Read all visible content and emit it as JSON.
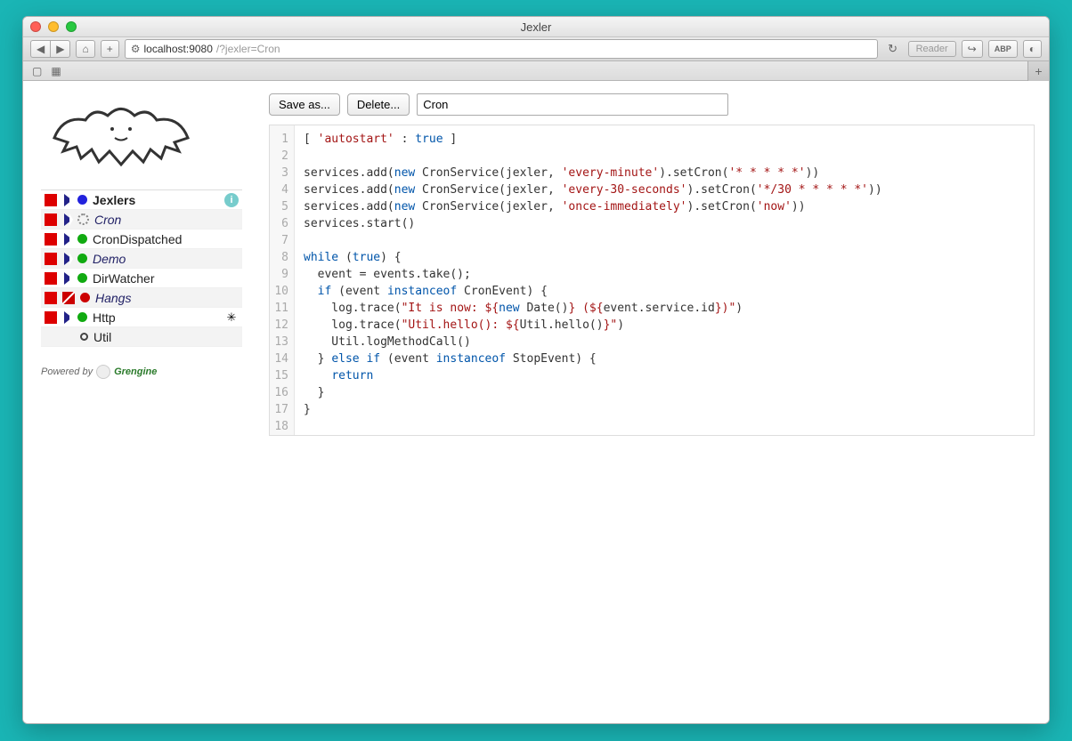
{
  "window": {
    "title": "Jexler"
  },
  "browser": {
    "url_host": "localhost:9080",
    "url_query": "/?jexler=Cron",
    "reader_label": "Reader"
  },
  "sidebar": {
    "items": [
      {
        "name": "Jexlers",
        "bold": true,
        "status": "blue",
        "trail": "info"
      },
      {
        "name": "Cron",
        "italic": true,
        "status": "spinner"
      },
      {
        "name": "CronDispatched",
        "status": "green"
      },
      {
        "name": "Demo",
        "italic": true,
        "status": "green"
      },
      {
        "name": "DirWatcher",
        "status": "green"
      },
      {
        "name": "Hangs",
        "italic": true,
        "status": "red",
        "diag": true
      },
      {
        "name": "Http",
        "status": "green",
        "trail": "cog"
      },
      {
        "name": "Util",
        "status": "ring",
        "nocontrols": true
      }
    ],
    "powered_by": "Powered by",
    "engine": "Grengine"
  },
  "toolbar": {
    "save_label": "Save as...",
    "delete_label": "Delete...",
    "name_value": "Cron"
  },
  "code": {
    "line_count": 18,
    "l1a": "[ ",
    "l1b": "'autostart'",
    "l1c": " : ",
    "l1d": "true",
    "l1e": " ]",
    "l3a": "services.add(",
    "l3b": "new",
    "l3c": " CronService(jexler, ",
    "l3d": "'every-minute'",
    "l3e": ").setCron(",
    "l3f": "'* * * * *'",
    "l3g": "))",
    "l4d": "'every-30-seconds'",
    "l4f": "'*/30 * * * * *'",
    "l5d": "'once-immediately'",
    "l5f": "'now'",
    "l6": "services.start()",
    "l8a": "while",
    "l8b": " (",
    "l8c": "true",
    "l8d": ") {",
    "l9": "  event = events.take();",
    "l10a": "  ",
    "l10b": "if",
    "l10c": " (event ",
    "l10d": "instanceof",
    "l10e": " CronEvent) {",
    "l11a": "    log.trace(",
    "l11b": "\"It is now: ${",
    "l11c": "new",
    "l11d": " Date()",
    "l11e": "} (${",
    "l11f": "event.service.id",
    "l11g": "})\"",
    "l11h": ")",
    "l12a": "    log.trace(",
    "l12b": "\"Util.hello(): ${",
    "l12c": "Util.hello()",
    "l12d": "}\"",
    "l12e": ")",
    "l13": "    Util.logMethodCall()",
    "l14a": "  } ",
    "l14b": "else if",
    "l14c": " (event ",
    "l14d": "instanceof",
    "l14e": " StopEvent) {",
    "l15a": "    ",
    "l15b": "return",
    "l16": "  }",
    "l17": "}"
  }
}
